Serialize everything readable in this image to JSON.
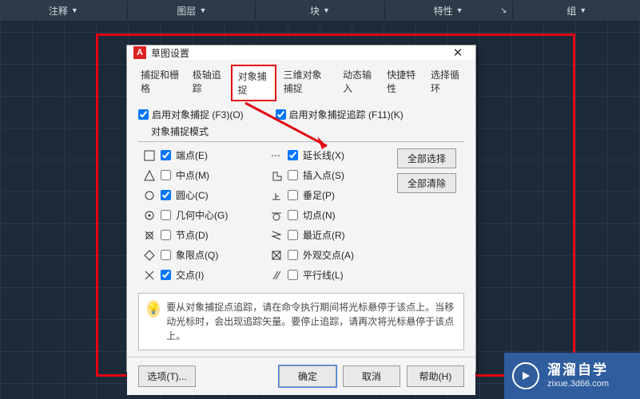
{
  "ribbon": {
    "panels": [
      "注释",
      "图层",
      "块",
      "特性",
      "组"
    ]
  },
  "dialog": {
    "title": "草图设置",
    "logo": "A",
    "close": "✕",
    "tabs": [
      "捕捉和栅格",
      "极轴追踪",
      "对象捕捉",
      "三维对象捕捉",
      "动态输入",
      "快捷特性",
      "选择循环"
    ],
    "activeTabIndex": 2,
    "enableOsnap": "启用对象捕捉 (F3)(O)",
    "enableOsnapTrack": "启用对象捕捉追踪 (F11)(K)",
    "groupLabel": "对象捕捉模式",
    "selectAll": "全部选择",
    "clearAll": "全部清除",
    "modesLeft": [
      {
        "label": "端点(E)",
        "checked": true
      },
      {
        "label": "中点(M)",
        "checked": false
      },
      {
        "label": "圆心(C)",
        "checked": true
      },
      {
        "label": "几何中心(G)",
        "checked": false
      },
      {
        "label": "节点(D)",
        "checked": false
      },
      {
        "label": "象限点(Q)",
        "checked": false
      },
      {
        "label": "交点(I)",
        "checked": true
      }
    ],
    "modesRight": [
      {
        "label": "延长线(X)",
        "checked": true
      },
      {
        "label": "插入点(S)",
        "checked": false
      },
      {
        "label": "垂足(P)",
        "checked": false
      },
      {
        "label": "切点(N)",
        "checked": false
      },
      {
        "label": "最近点(R)",
        "checked": false
      },
      {
        "label": "外观交点(A)",
        "checked": false
      },
      {
        "label": "平行线(L)",
        "checked": false
      }
    ],
    "tip": "要从对象捕捉点追踪，请在命令执行期间将光标悬停于该点上。当移动光标时，会出现追踪矢量。要停止追踪，请再次将光标悬停于该点上。",
    "options": "选项(T)...",
    "ok": "确定",
    "cancel": "取消",
    "help": "帮助(H)"
  },
  "watermark": {
    "brand": "溜溜自学",
    "url": "zixue.3d66.com"
  }
}
